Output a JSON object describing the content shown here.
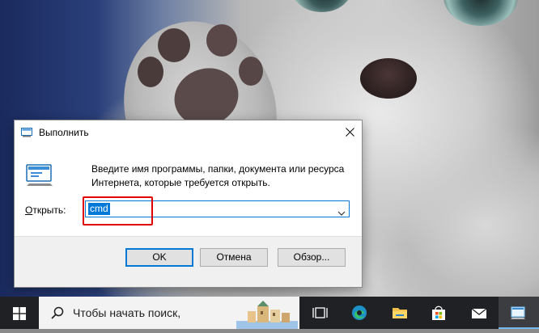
{
  "dialog": {
    "title": "Выполнить",
    "description": "Введите имя программы, папки, документа или ресурса Интернета, которые требуется открыть.",
    "open_label_first": "О",
    "open_label_rest": "ткрыть:",
    "command_value": "cmd",
    "buttons": {
      "ok": "OK",
      "cancel": "Отмена",
      "browse": "Обзор..."
    }
  },
  "taskbar": {
    "search_placeholder": "Чтобы начать поиск,",
    "icons": [
      "windows-start-icon",
      "task-view-icon",
      "edge-icon",
      "file-explorer-icon",
      "store-icon",
      "mail-icon",
      "run-app-icon"
    ]
  },
  "colors": {
    "accent": "#0078d7",
    "highlight_box": "#e00000",
    "taskbar": "#1f2124"
  }
}
